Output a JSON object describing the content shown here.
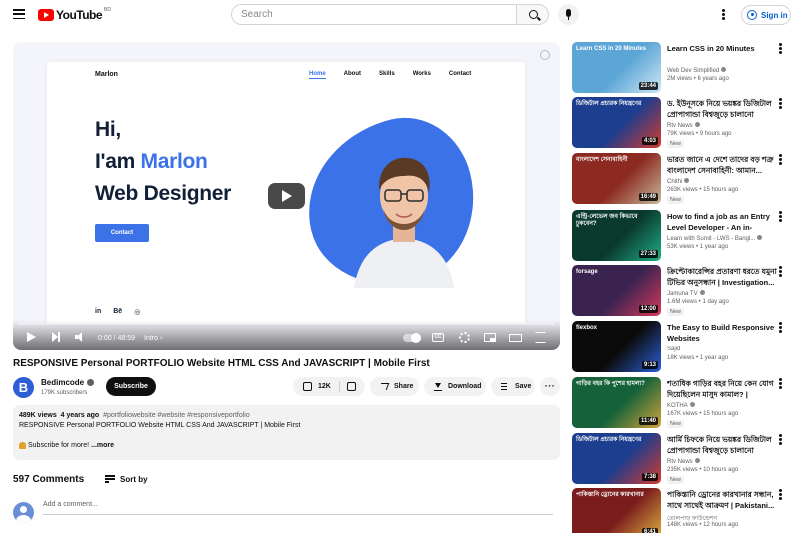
{
  "header": {
    "logo_text": "YouTube",
    "country_code": "BD",
    "search_placeholder": "Search",
    "signin_label": "Sign in"
  },
  "player": {
    "site": {
      "brand": "Marlon",
      "nav": [
        "Home",
        "About",
        "Skills",
        "Works",
        "Contact"
      ],
      "hero_line1": "Hi,",
      "hero_prefix": "I'am ",
      "hero_name": "Marlon",
      "hero_line3": "Web Designer",
      "contact_button": "Contact",
      "social": [
        "in",
        "Bē",
        "◎"
      ]
    },
    "time": "0:00 / 48:59",
    "chapter": "Intro",
    "cc_label": "CC",
    "progress": 0
  },
  "video": {
    "title": "RESPONSIVE Personal PORTFOLIO Website HTML CSS And JAVASCRIPT | Mobile First",
    "channel": "Bedimcode",
    "channel_initial": "B",
    "subscribers": "179K subscribers",
    "subscribe_label": "Subscribe",
    "likes": "12K",
    "share_label": "Share",
    "download_label": "Download",
    "save_label": "Save",
    "more_label": "···"
  },
  "description": {
    "views": "489K views",
    "age": "4 years ago",
    "tags": "#portfoliowebsite #website #responsiveportfolio",
    "line": "RESPONSIVE Personal PORTFOLIO Website HTML CSS And JAVASCRIPT | Mobile First",
    "subscribe_line": "Subscribe for more!",
    "more": "...more"
  },
  "comments": {
    "count": "597 Comments",
    "sort_label": "Sort by",
    "placeholder": "Add a comment..."
  },
  "recommendations": [
    {
      "title": "Learn CSS in 20 Minutes",
      "channel": "Web Dev Simplified",
      "views": "2M views",
      "age": "6 years ago",
      "duration": "23:44",
      "verified": true,
      "new": "",
      "thumb_text": "Learn CSS in 20 Minutes",
      "color1": "#5ba6d6",
      "color2": "#cfe6f5"
    },
    {
      "title": "ড. ইউনূসকে নিয়ে ভয়ঙ্কর ডিজিটাল প্রোপাগান্ডা বিশ্বজুড়ে চালানো ভারতের বিশাল নেটওয়ার্ক",
      "channel": "Rtv News",
      "views": "79K views",
      "age": "9 hours ago",
      "duration": "4:03",
      "verified": true,
      "new": "New",
      "thumb_text": "ডিজিটাল প্রচারক নিয়ন্ত্রণের",
      "color1": "#1d3d8f",
      "color2": "#d33b2c"
    },
    {
      "title": "ভারত জানে এ দেশে তাদের বড় শত্রু বাংলাদেশ সেনাবাহিনী: আমান...",
      "channel": "Chithi",
      "views": "263K views",
      "age": "15 hours ago",
      "duration": "16:49",
      "verified": true,
      "new": "New",
      "thumb_text": "বাংলাদেশ সেনাবাহিনী",
      "color1": "#8c2a22",
      "color2": "#c9b99a"
    },
    {
      "title": "How to find a job as an Entry Level Developer - An in-depth...",
      "channel": "Learn with Sumit - LWS - Bangl...",
      "views": "53K views",
      "age": "1 year ago",
      "duration": "27:33",
      "verified": true,
      "new": "",
      "thumb_text": "এন্ট্রি-লেভেল জব কিভাবে ঢুকবেন?",
      "color1": "#0a3a2e",
      "color2": "#1fae85"
    },
    {
      "title": "ক্রিপ্টোকারেন্সির প্রতারণা ধরতে যমুনা টিভির অনুসন্ধান | Investigation...",
      "channel": "Jamuna TV",
      "views": "1.6M views",
      "age": "1 day ago",
      "duration": "12:00",
      "verified": true,
      "new": "New",
      "thumb_text": "forsage",
      "color1": "#3b2350",
      "color2": "#d83a5a"
    },
    {
      "title": "The Easy to Build Responsive Websites",
      "channel": "Sajid",
      "views": "18K views",
      "age": "1 year ago",
      "duration": "9:13",
      "verified": false,
      "new": "",
      "thumb_text": "flexbox",
      "color1": "#0b0b0b",
      "color2": "#2a5fd8"
    },
    {
      "title": "শতাধিক গাড়ির বহর নিয়ে কেন যোগ দিয়েছিলেন মাসুদ কামাল? | Masood Kamal |...",
      "channel": "KOTHA",
      "views": "167K views",
      "age": "15 hours ago",
      "duration": "11:40",
      "verified": true,
      "new": "New",
      "thumb_text": "গাড়ির বহর কি পুশের হামলা?",
      "color1": "#15623a",
      "color2": "#d2a43a"
    },
    {
      "title": "আর্মি চিফকে নিয়ে ভয়ঙ্কর ডিজিটাল প্রোপাগান্ডা বিশ্বজুড়ে চালানো ভারতের ষড়যন্ত্র ও কল...",
      "channel": "Rtv News",
      "views": "235K views",
      "age": "10 hours ago",
      "duration": "7:38",
      "verified": true,
      "new": "New",
      "thumb_text": "ডিজিটাল প্রচারক নিয়ন্ত্রণের",
      "color1": "#1d3d8f",
      "color2": "#d33b2c"
    },
    {
      "title": "পাকিস্তানি ড্রোনের কারখানার সন্ধান, সাথে সাথেই আক্রমণ | Pakistani...",
      "channel": "তোলপাড় ফাউন্ডেশন",
      "views": "148K views",
      "age": "12 hours ago",
      "duration": "6:41",
      "verified": false,
      "new": "",
      "thumb_text": "পাকিস্তানি ড্রোনের কারখানার",
      "color1": "#7a1c1c",
      "color2": "#e0b040"
    }
  ]
}
